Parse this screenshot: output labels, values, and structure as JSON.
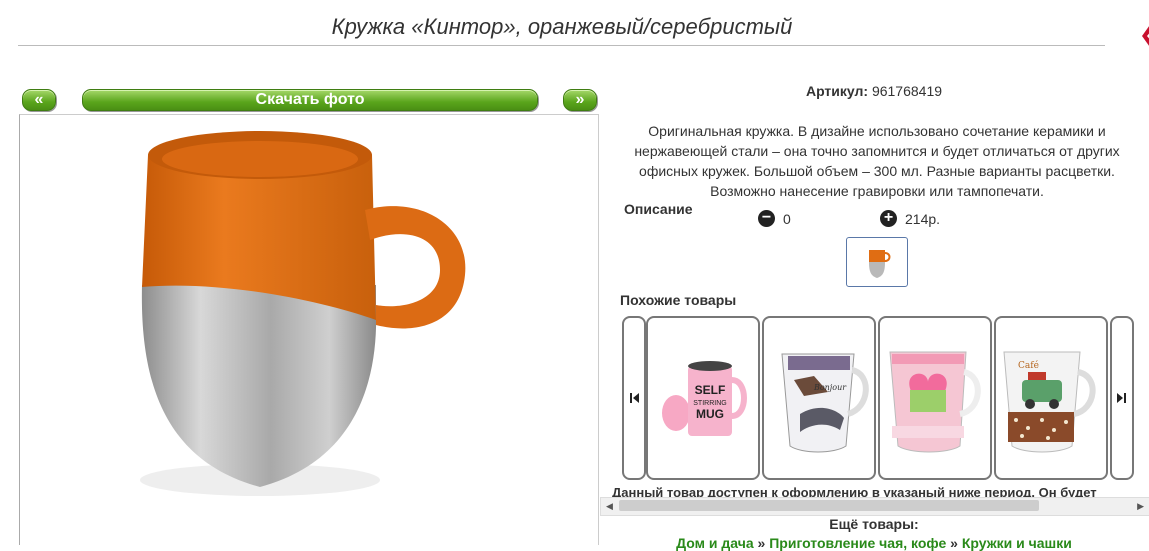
{
  "product": {
    "title": "Кружка «Кинтор», оранжевый/серебристый",
    "download_label": "Скачать фото",
    "prev_label": "«",
    "next_label": "»",
    "sku_label": "Артикул:",
    "sku_value": "961768419",
    "description": "Оригинальная кружка. В дизайне использовано сочетание керамики и нержавеющей стали – она точно запомнится и будет отличаться от других офисных кружек. Большой объем – 300 мл. Разные варианты расцветки. Возможно нанесение гравировки или тампопечати.",
    "description_label": "Описание",
    "minus_value": "0",
    "plus_value": "214р."
  },
  "similar": {
    "label": "Похожие товары",
    "items": [
      {
        "text1": "SELF",
        "text2": "STIRRING",
        "text3": "MUG"
      },
      {
        "text1": "Bonjour"
      },
      {
        "text1": ""
      },
      {
        "text1": "Café"
      }
    ]
  },
  "availability_text": "Данный товар доступен к оформлению в указаный ниже период. Он будет",
  "more": {
    "label": "Ещё товары:",
    "crumbs": [
      "Дом и дача",
      "Приготовление чая, кофе",
      "Кружки и чашки"
    ],
    "separator": "»"
  },
  "colors": {
    "accent_green": "#5aa51c",
    "link_green": "#2a8a1a",
    "mug_orange": "#e06d13",
    "steel": "#b9b9b9"
  }
}
